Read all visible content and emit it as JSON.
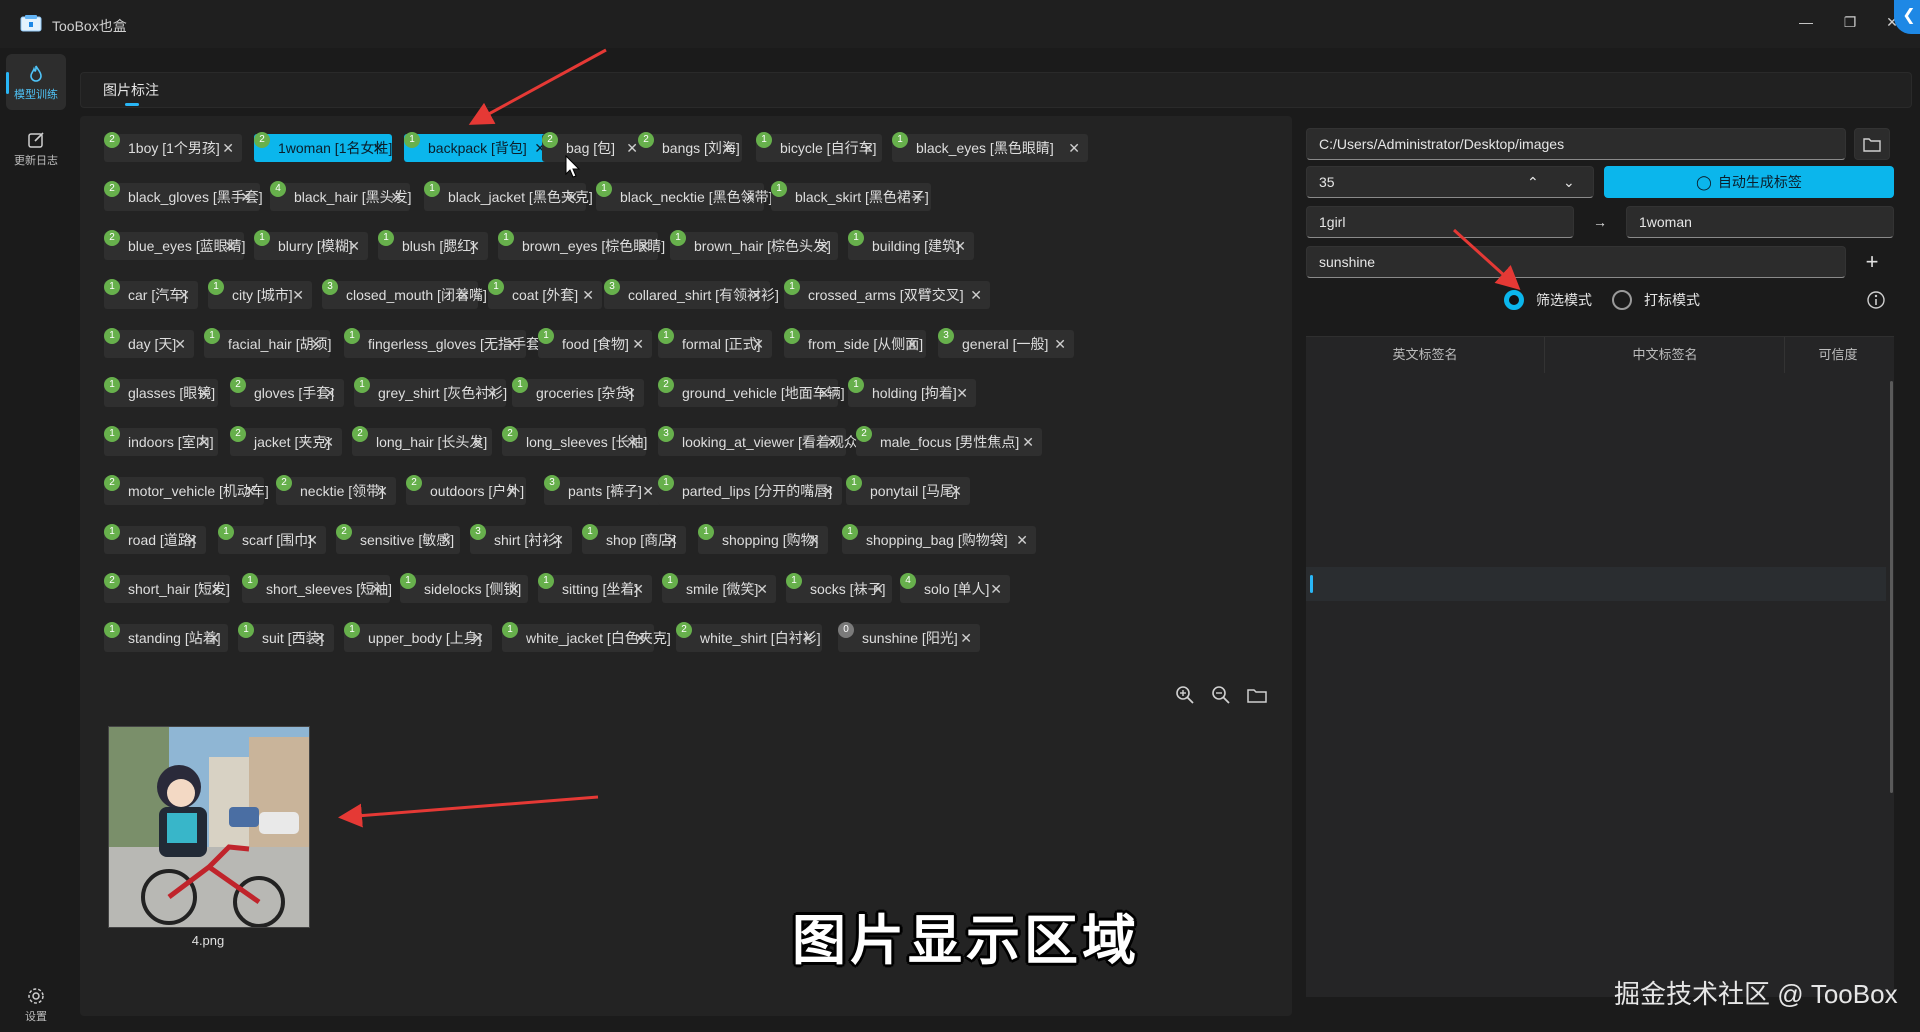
{
  "window": {
    "title": "TooBox也盒",
    "controls": [
      "minimize-icon",
      "restore-icon",
      "close-icon"
    ],
    "back_icon": "chevron-left-icon"
  },
  "nav": {
    "items": [
      {
        "label": "模型训练",
        "icon": "flame-icon",
        "active": true
      },
      {
        "label": "更新日志",
        "icon": "edit-icon",
        "active": false
      }
    ],
    "settings_label": "设置"
  },
  "tabs": [
    {
      "label": "图片标注",
      "active": true
    }
  ],
  "tags": {
    "rows": [
      [
        {
          "text": "1boy [1个男孩]",
          "count": "2"
        },
        {
          "text": "1woman [1名女性]",
          "count": "2",
          "selected": true
        },
        {
          "text": "backpack [背包]",
          "count": "1",
          "selected": true
        },
        {
          "text": "bag [包]",
          "count": "2"
        },
        {
          "text": "bangs [刘海]",
          "count": "2"
        },
        {
          "text": "bicycle [自行车]",
          "count": "1"
        },
        {
          "text": "black_eyes [黑色眼睛]",
          "count": "1"
        }
      ],
      [
        {
          "text": "black_gloves [黑手套]",
          "count": "2"
        },
        {
          "text": "black_hair [黑头发]",
          "count": "4"
        },
        {
          "text": "black_jacket [黑色夹克]",
          "count": "1"
        },
        {
          "text": "black_necktie [黑色领带]",
          "count": "1"
        },
        {
          "text": "black_skirt [黑色裙子]",
          "count": "1"
        }
      ],
      [
        {
          "text": "blue_eyes [蓝眼睛]",
          "count": "2"
        },
        {
          "text": "blurry [模糊]",
          "count": "1"
        },
        {
          "text": "blush [腮红]",
          "count": "1"
        },
        {
          "text": "brown_eyes [棕色眼睛]",
          "count": "1"
        },
        {
          "text": "brown_hair [棕色头发]",
          "count": "1"
        },
        {
          "text": "building [建筑]",
          "count": "1"
        }
      ],
      [
        {
          "text": "car [汽车]",
          "count": "1"
        },
        {
          "text": "city [城市]",
          "count": "1"
        },
        {
          "text": "closed_mouth [闭着嘴]",
          "count": "3"
        },
        {
          "text": "coat [外套]",
          "count": "1"
        },
        {
          "text": "collared_shirt [有领衬衫]",
          "count": "3"
        },
        {
          "text": "crossed_arms [双臂交叉]",
          "count": "1"
        }
      ],
      [
        {
          "text": "day [天]",
          "count": "1"
        },
        {
          "text": "facial_hair [胡须]",
          "count": "1"
        },
        {
          "text": "fingerless_gloves [无指手套]",
          "count": "1"
        },
        {
          "text": "food [食物]",
          "count": "1"
        },
        {
          "text": "formal [正式]",
          "count": "1"
        },
        {
          "text": "from_side [从侧面]",
          "count": "1"
        },
        {
          "text": "general [一般]",
          "count": "3"
        }
      ],
      [
        {
          "text": "glasses [眼镜]",
          "count": "1"
        },
        {
          "text": "gloves [手套]",
          "count": "2"
        },
        {
          "text": "grey_shirt [灰色衬衫]",
          "count": "1"
        },
        {
          "text": "groceries [杂货]",
          "count": "1"
        },
        {
          "text": "ground_vehicle [地面车辆]",
          "count": "2"
        },
        {
          "text": "holding [拘着]",
          "count": "1"
        }
      ],
      [
        {
          "text": "indoors [室内]",
          "count": "1"
        },
        {
          "text": "jacket [夹克]",
          "count": "2"
        },
        {
          "text": "long_hair [长头发]",
          "count": "2"
        },
        {
          "text": "long_sleeves [长袖]",
          "count": "2"
        },
        {
          "text": "looking_at_viewer [看着观众]",
          "count": "3"
        },
        {
          "text": "male_focus [男性焦点]",
          "count": "2"
        }
      ],
      [
        {
          "text": "motor_vehicle [机动车]",
          "count": "2"
        },
        {
          "text": "necktie [领带]",
          "count": "2"
        },
        {
          "text": "outdoors [户外]",
          "count": "2"
        },
        {
          "text": "pants [裤子]",
          "count": "3"
        },
        {
          "text": "parted_lips [分开的嘴唇]",
          "count": "1"
        },
        {
          "text": "ponytail [马尾]",
          "count": "1"
        }
      ],
      [
        {
          "text": "road [道路]",
          "count": "1"
        },
        {
          "text": "scarf [围巾]",
          "count": "1"
        },
        {
          "text": "sensitive [敏感]",
          "count": "2"
        },
        {
          "text": "shirt [衬衫]",
          "count": "3"
        },
        {
          "text": "shop [商店]",
          "count": "1"
        },
        {
          "text": "shopping [购物]",
          "count": "1"
        },
        {
          "text": "shopping_bag [购物袋]",
          "count": "1"
        }
      ],
      [
        {
          "text": "short_hair [短发]",
          "count": "2"
        },
        {
          "text": "short_sleeves [短袖]",
          "count": "1"
        },
        {
          "text": "sidelocks [侧锁]",
          "count": "1"
        },
        {
          "text": "sitting [坐着]",
          "count": "1"
        },
        {
          "text": "smile [微笑]",
          "count": "1"
        },
        {
          "text": "socks [袜子]",
          "count": "1"
        },
        {
          "text": "solo [单人]",
          "count": "4"
        }
      ],
      [
        {
          "text": "standing [站着]",
          "count": "1"
        },
        {
          "text": "suit [西装]",
          "count": "1"
        },
        {
          "text": "upper_body [上身]",
          "count": "1"
        },
        {
          "text": "white_jacket [白色夹克]",
          "count": "1"
        },
        {
          "text": "white_shirt [白衬衫]",
          "count": "2"
        },
        {
          "text": "sunshine [阳光]",
          "count": "0"
        }
      ]
    ]
  },
  "image_toolbar": {
    "icons": [
      "zoom-in-icon",
      "zoom-out-icon",
      "folder-icon"
    ]
  },
  "thumbnail": {
    "filename": "4.png"
  },
  "right": {
    "path_value": "C:/Users/Administrator/Desktop/images",
    "number_value": "35",
    "auto_tag_label": "自动生成标签",
    "replace_from_value": "1girl",
    "replace_to_value": "1woman",
    "new_tag_value": "sunshine",
    "modes": [
      {
        "label": "筛选模式",
        "selected": true
      },
      {
        "label": "打标模式",
        "selected": false
      }
    ],
    "table_headers": [
      "英文标签名",
      "中文标签名",
      "可信度"
    ]
  },
  "overlay": {
    "caption": "图片显示区域",
    "watermark": "掘金技术社区 @ TooBox"
  },
  "colors": {
    "accent": "#0bb6ec",
    "badge": "#67b04c",
    "arrow": "#e53935",
    "background": "#1b1b1b"
  }
}
